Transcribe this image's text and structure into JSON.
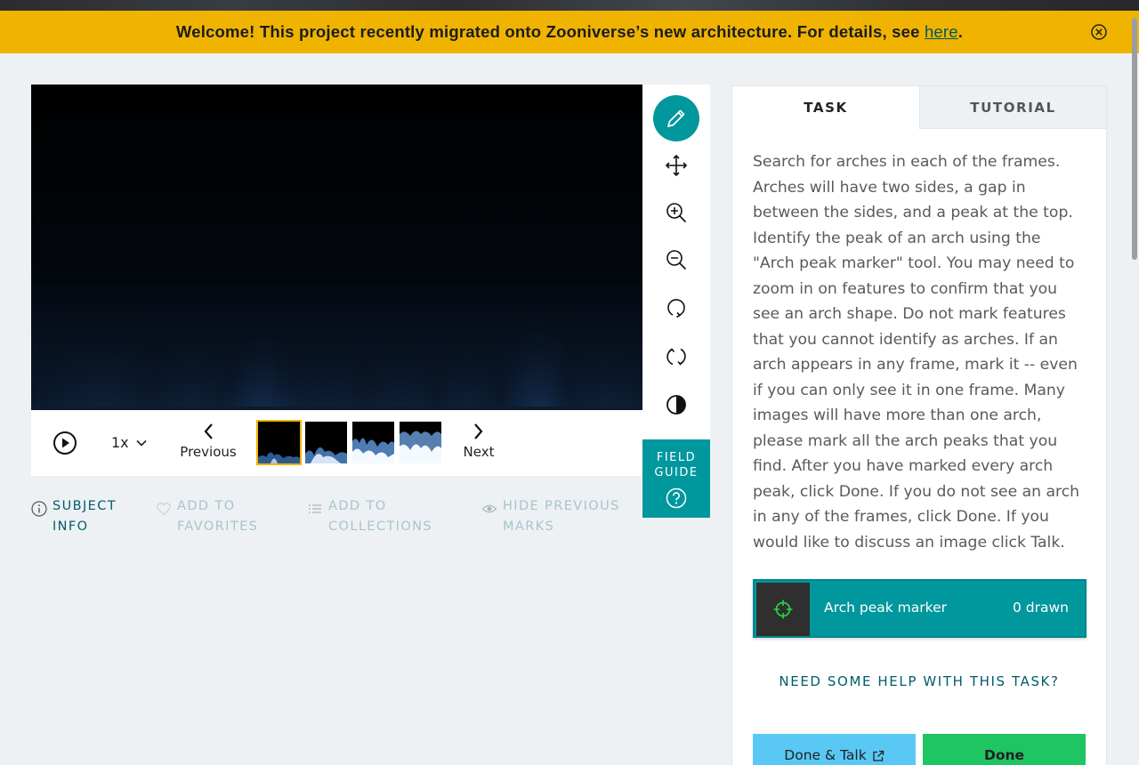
{
  "banner": {
    "text": "Welcome! This project recently migrated onto Zooniverse’s new architecture. For details, see ",
    "link_text": "here",
    "suffix": "."
  },
  "viewer": {
    "playback_rate": "1x",
    "previous_label": "Previous",
    "next_label": "Next",
    "frames": [
      {
        "frame": 1,
        "active": true
      },
      {
        "frame": 2,
        "active": false
      },
      {
        "frame": 3,
        "active": false
      },
      {
        "frame": 4,
        "active": false
      }
    ]
  },
  "toolbar": {
    "tools": [
      "pencil-icon",
      "move-icon",
      "zoom-in-icon",
      "zoom-out-icon",
      "rotate-icon",
      "reset-icon",
      "invert-icon"
    ],
    "field_guide_line1": "FIELD",
    "field_guide_line2": "GUIDE"
  },
  "meta": {
    "subject_info": [
      "SUBJECT",
      "INFO"
    ],
    "add_to_favorites": [
      "ADD TO",
      "FAVORITES"
    ],
    "add_to_collections": [
      "ADD TO",
      "COLLECTIONS"
    ],
    "hide_previous_marks": [
      "HIDE PREVIOUS",
      "MARKS"
    ]
  },
  "panel": {
    "tab_task": "TASK",
    "tab_tutorial": "TUTORIAL",
    "instructions": "Search for arches in each of the frames. Arches will have two sides, a gap in between the sides, and a peak at the top. Identify the peak of an arch using the \"Arch peak marker\" tool. You may need to zoom in on features to confirm that you see an arch shape. Do not mark features that you cannot identify as arches. If an arch appears in any frame, mark it -- even if you can only see it in one frame. Many images will have more than one arch, please mark all the arch peaks that you find. After you have marked every arch peak, click Done. If you do not see an arch in any of the frames, click Done. If you would like to discuss an image click Talk.",
    "tool_label": "Arch peak marker",
    "tool_count": "0 drawn",
    "help_link": "NEED SOME HELP WITH THIS TASK?",
    "done_talk": "Done & Talk",
    "done": "Done"
  },
  "colors": {
    "banner": "#f0b400",
    "teal": "#00979d",
    "done_talk": "#5ac8f5",
    "done": "#1fc563"
  }
}
